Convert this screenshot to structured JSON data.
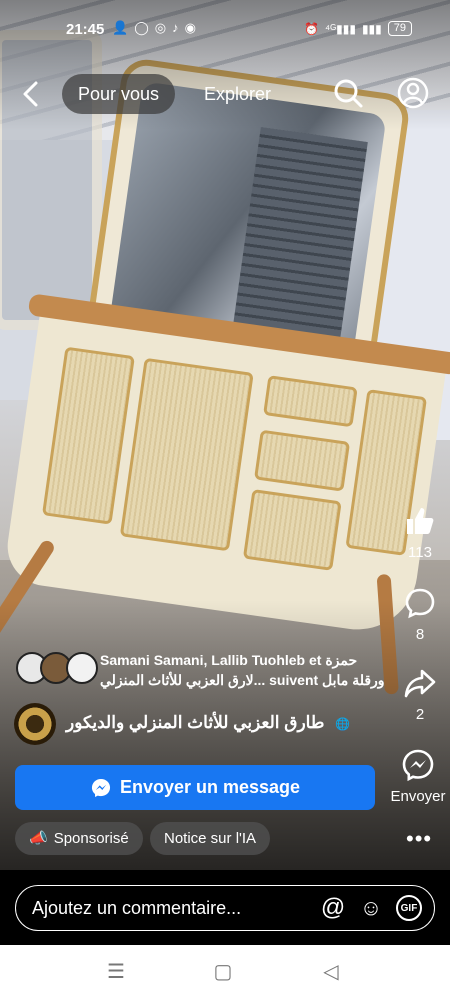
{
  "status": {
    "time": "21:45",
    "icons_left": [
      "person-icon",
      "whatsapp-icon",
      "messenger-icon",
      "tiktok-icon",
      "app-icon"
    ],
    "battery": "79",
    "signal_text": "⁴ᴳ"
  },
  "nav": {
    "active_tab": "Pour vous",
    "tab2": "Explorer"
  },
  "post": {
    "likers": "Samani Samani, Lallib Tuohleb et حمزة",
    "likers_line2": "ورقلة مابل suivent ...لارق العزبي للأثاث المنزلي",
    "page_name": "طارق العزبي للأثاث المنزلي والديكور",
    "cta": "Envoyer un message",
    "sponsored": "Sponsorisé",
    "ai_notice": "Notice sur l'IA"
  },
  "actions": {
    "likes": "113",
    "comments": "8",
    "shares": "2",
    "send_label": "Envoyer"
  },
  "comment": {
    "placeholder": "Ajoutez un commentaire..."
  },
  "colors": {
    "cta": "#1877f2",
    "background": "#000000"
  }
}
